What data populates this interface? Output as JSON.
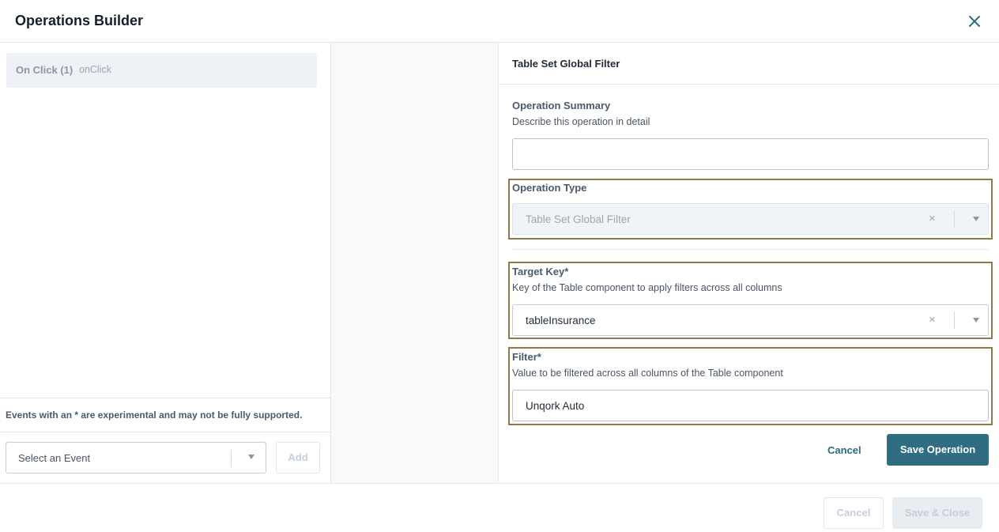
{
  "header": {
    "title": "Operations Builder",
    "close_icon": "close-icon"
  },
  "events_panel": {
    "items": [
      {
        "label": "On Click (1)",
        "key": "onClick"
      }
    ],
    "note": "Events with an * are experimental and may not be fully supported.",
    "event_select": {
      "value": "Select an Event",
      "icon": "chevron-down-icon"
    },
    "add_label": "Add"
  },
  "operation_form": {
    "title": "Table Set Global Filter",
    "summary": {
      "label": "Operation Summary",
      "description": "Describe this operation in detail",
      "value": ""
    },
    "operation_type": {
      "label": "Operation Type",
      "value": "Table Set Global Filter",
      "clear_icon": "×"
    },
    "target_key": {
      "label": "Target Key*",
      "description": "Key of the Table component to apply filters across all columns",
      "value": "tableInsurance",
      "clear_icon": "×"
    },
    "filter": {
      "label": "Filter*",
      "description": "Value to be filtered across all columns of the Table component",
      "value": "Unqork Auto"
    },
    "cancel_label": "Cancel",
    "save_label": "Save Operation",
    "highlight_color": "#8e7a46",
    "accent_color": "#2f6d82"
  },
  "footer": {
    "cancel_label": "Cancel",
    "save_close_label": "Save & Close"
  }
}
